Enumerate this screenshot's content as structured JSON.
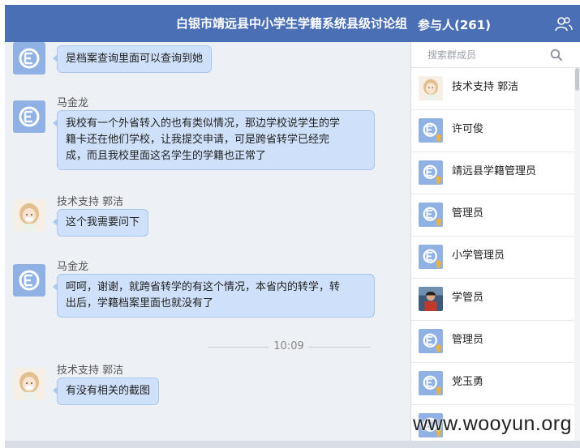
{
  "header": {
    "title": "白银市靖远县中小学生学籍系统县级讨论组"
  },
  "panel": {
    "title": "参与人(261)",
    "search_placeholder": "搜索群成员",
    "members": [
      {
        "name": "技术支持 郭洁",
        "avatar": "girl"
      },
      {
        "name": "许可俊",
        "avatar": "default-admin"
      },
      {
        "name": "靖远县学籍管理员",
        "avatar": "default-admin"
      },
      {
        "name": "管理员",
        "avatar": "default-admin"
      },
      {
        "name": "小学管理员",
        "avatar": "default-admin"
      },
      {
        "name": "学管员",
        "avatar": "photo"
      },
      {
        "name": "管理员",
        "avatar": "default-admin"
      },
      {
        "name": "党玉勇",
        "avatar": "default-admin"
      },
      {
        "name": "",
        "avatar": "default-admin"
      }
    ]
  },
  "messages": [
    {
      "sender": "",
      "text": "是档案查询里面可以查询到她",
      "avatar": "default"
    },
    {
      "sender": "马金龙",
      "lines": [
        "我校有一个外省转入的也有类似情况，那边学校说学生的学",
        "籍卡还在他们学校，让我提交申请，可是跨省转学已经完",
        "成，而且我校里面这名学生的学籍也正常了"
      ],
      "avatar": "default"
    },
    {
      "sender": "技术支持 郭洁",
      "text": "这个我需要问下",
      "avatar": "girl"
    },
    {
      "sender": "马金龙",
      "lines": [
        "呵呵，谢谢，就跨省转学的有这个情况，本省内的转学，转",
        "出后，学籍档案里面也就没有了"
      ],
      "avatar": "default"
    },
    {
      "sender": "技术支持 郭洁",
      "text": "有没有相关的截图",
      "avatar": "girl"
    }
  ],
  "time_divider": "10:09",
  "watermark": "www.wooyun.org",
  "colors": {
    "header": "#4a6fb5",
    "bubble": "#cfe1fa",
    "chat_bg": "#edf0f5"
  }
}
